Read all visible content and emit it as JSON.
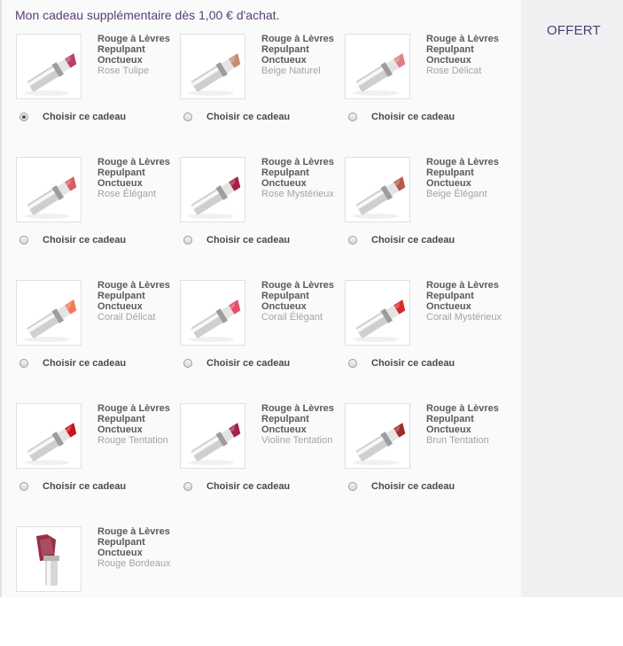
{
  "header": {
    "text": "Mon cadeau supplémentaire dès 1,00 € d'achat."
  },
  "aside": {
    "offer_label": "OFFERT"
  },
  "gifts": [
    {
      "name": "Rouge à Lèvres Repulpant Onctueux",
      "shade": "Rose Tulipe",
      "color": "#b5426a",
      "choose_label": "Choisir ce cadeau",
      "selected": true
    },
    {
      "name": "Rouge à Lèvres Repulpant Onctueux",
      "shade": "Beige Naturel",
      "color": "#c98a72",
      "choose_label": "Choisir ce cadeau",
      "selected": false
    },
    {
      "name": "Rouge à Lèvres Repulpant Onctueux",
      "shade": "Rose Délicat",
      "color": "#e07e85",
      "choose_label": "Choisir ce cadeau",
      "selected": false
    },
    {
      "name": "Rouge à Lèvres Repulpant Onctueux",
      "shade": "Rose Élégant",
      "color": "#d75d62",
      "choose_label": "Choisir ce cadeau",
      "selected": false
    },
    {
      "name": "Rouge à Lèvres Repulpant Onctueux",
      "shade": "Rose Mystérieux",
      "color": "#a62046",
      "choose_label": "Choisir ce cadeau",
      "selected": false
    },
    {
      "name": "Rouge à Lèvres Repulpant Onctueux",
      "shade": "Beige Élégant",
      "color": "#b45a4e",
      "choose_label": "Choisir ce cadeau",
      "selected": false
    },
    {
      "name": "Rouge à Lèvres Repulpant Onctueux",
      "shade": "Corail Délicat",
      "color": "#f07a5c",
      "choose_label": "Choisir ce cadeau",
      "selected": false
    },
    {
      "name": "Rouge à Lèvres Repulpant Onctueux",
      "shade": "Corail Élégant",
      "color": "#e2506a",
      "choose_label": "Choisir ce cadeau",
      "selected": false
    },
    {
      "name": "Rouge à Lèvres Repulpant Onctueux",
      "shade": "Corail Mystérieux",
      "color": "#d82a2c",
      "choose_label": "Choisir ce cadeau",
      "selected": false
    },
    {
      "name": "Rouge à Lèvres Repulpant Onctueux",
      "shade": "Rouge Tentation",
      "color": "#c8141c",
      "choose_label": "Choisir ce cadeau",
      "selected": false
    },
    {
      "name": "Rouge à Lèvres Repulpant Onctueux",
      "shade": "Violine Tentation",
      "color": "#a4204e",
      "choose_label": "Choisir ce cadeau",
      "selected": false
    },
    {
      "name": "Rouge à Lèvres Repulpant Onctueux",
      "shade": "Brun Tentation",
      "color": "#9e2c28",
      "choose_label": "Choisir ce cadeau",
      "selected": false
    },
    {
      "name": "Rouge à Lèvres Repulpant Onctueux",
      "shade": "Rouge Bordeaux",
      "color": "#8e1630",
      "choose_label": "",
      "selected": false
    }
  ]
}
